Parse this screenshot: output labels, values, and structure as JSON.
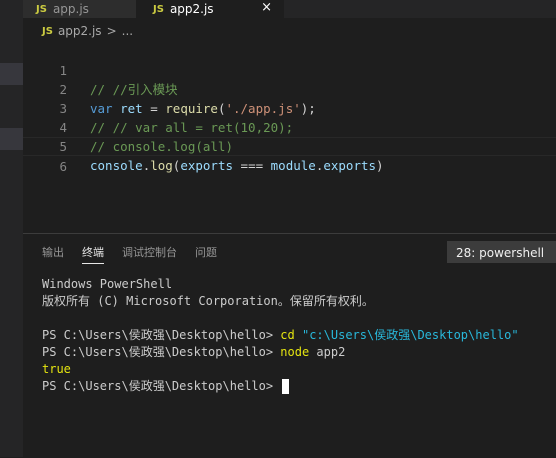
{
  "tabs": [
    {
      "icon": "JS",
      "label": "app.js"
    },
    {
      "icon": "JS",
      "label": "app2.js",
      "close": "×"
    }
  ],
  "breadcrumb": {
    "icon": "JS",
    "file": "app2.js",
    "sep": ">",
    "rest": "..."
  },
  "editor": {
    "line_numbers": [
      "1",
      "2",
      "3",
      "4",
      "5",
      "6"
    ],
    "line1": "// //引入模块",
    "line2": {
      "kw": "var",
      "name": " ret",
      "op": " = ",
      "fn": "require",
      "open": "(",
      "str": "'./app.js'",
      "close": ");"
    },
    "line3": "// // var all = ret(10,20);",
    "line4": "// console.log(all)",
    "line5": {
      "obj": "console",
      "dot1": ".",
      "fn": "log",
      "open": "(",
      "a": "exports",
      "op": " === ",
      "b": "module",
      "dot2": ".",
      "c": "exports",
      "close": ")"
    }
  },
  "panel": {
    "tabs": [
      "输出",
      "终端",
      "调试控制台",
      "问题"
    ],
    "active_tab": "终端",
    "terminal_select": "28: powershell",
    "terminal": {
      "l1": "Windows PowerShell",
      "l2": "版权所有 (C) Microsoft Corporation。保留所有权利。",
      "p1": "PS C:\\Users\\侯政强\\Desktop\\hello> ",
      "cmd1": "cd",
      "arg1": " \"c:\\Users\\侯政强\\Desktop\\hello\"",
      "p2": "PS C:\\Users\\侯政强\\Desktop\\hello> ",
      "cmd2": "node",
      "arg2": " app2",
      "out": "true",
      "p3": "PS C:\\Users\\侯政强\\Desktop\\hello> "
    }
  }
}
